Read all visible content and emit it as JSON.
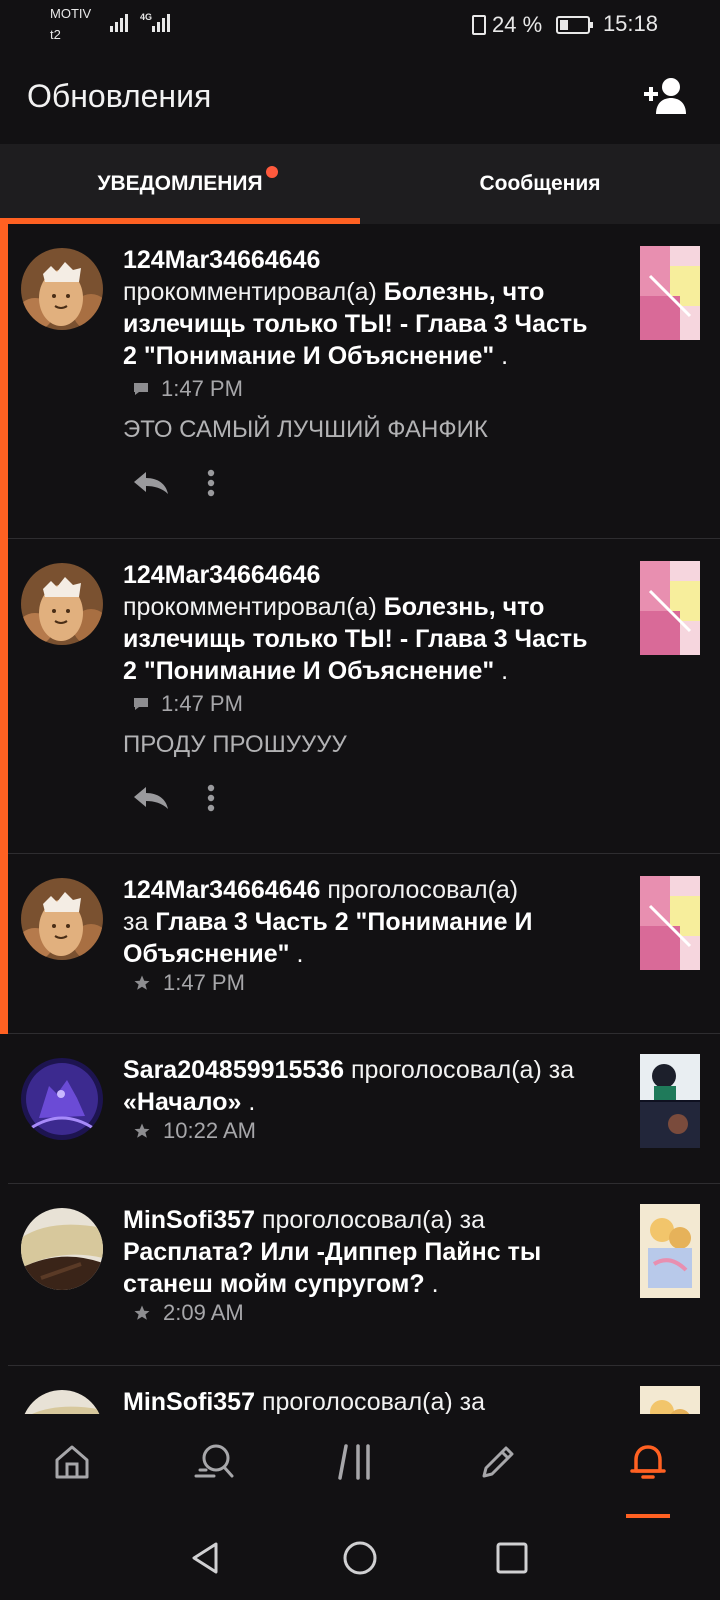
{
  "status_bar": {
    "carrier": "MOTIV",
    "carrier2": "t2",
    "network": "4G",
    "battery": "24 %",
    "time": "15:18"
  },
  "app_bar": {
    "title": "Обновления"
  },
  "tabs": [
    {
      "label": "УВЕДОМЛЕНИЯ",
      "active": true,
      "has_dot": true
    },
    {
      "label": "Сообщения",
      "active": false
    }
  ],
  "notifications": [
    {
      "user": "124Mar34664646",
      "verb": "прокомментировал(а)",
      "target_line1": "Болезнь, что",
      "target_line2": "излечищь только ТЫ! - Глава 3 Часть",
      "target_line3": "2 \"Понимание И Объяснение\"",
      "time": "1:47 PM",
      "meta_icon": "comment-icon",
      "comment": "ЭТО САМЫЙ ЛУЧШИЙ ФАНФИК",
      "unread": true
    },
    {
      "user": "124Mar34664646",
      "verb": "прокомментировал(а)",
      "target_line1": "Болезнь, что",
      "target_line2": "излечищь только ТЫ! - Глава 3 Часть",
      "target_line3": "2 \"Понимание И Объяснение\"",
      "time": "1:47 PM",
      "meta_icon": "comment-icon",
      "comment": "ПРОДУ ПРОШУУУУ",
      "unread": true
    },
    {
      "user": "124Mar34664646",
      "verb": "проголосовал(а)",
      "prefix": "за",
      "target_line1": "Глава 3 Часть 2 \"Понимание И",
      "target_line2": "Объяснение\"",
      "time": "1:47 PM",
      "meta_icon": "star-icon",
      "unread": true
    },
    {
      "user": "Sara204859915536",
      "verb": "проголосовал(а) за",
      "target_line1": "«Начало»",
      "time": "10:22 AM",
      "meta_icon": "star-icon",
      "unread": false
    },
    {
      "user": "MinSofi357",
      "verb": "проголосовал(а) за",
      "target_line1": "Расплата? Или -Диппер Пайнс ты",
      "target_line2": "станеш мойм супругом?",
      "time": "2:09 AM",
      "meta_icon": "star-icon",
      "unread": false
    },
    {
      "user": "MinSofi357",
      "verb": "проголосовал(а) за",
      "unread": false
    }
  ],
  "dot": ".",
  "bottom_nav": [
    {
      "icon": "home-icon",
      "active": false
    },
    {
      "icon": "search-icon",
      "active": false
    },
    {
      "icon": "library-icon",
      "active": false
    },
    {
      "icon": "write-icon",
      "active": false
    },
    {
      "icon": "bell-icon",
      "active": true
    }
  ],
  "colors": {
    "accent": "#ff6122",
    "background": "#121113",
    "tab_bar": "#1e1d1f",
    "meta_text": "#a7a7aa"
  }
}
